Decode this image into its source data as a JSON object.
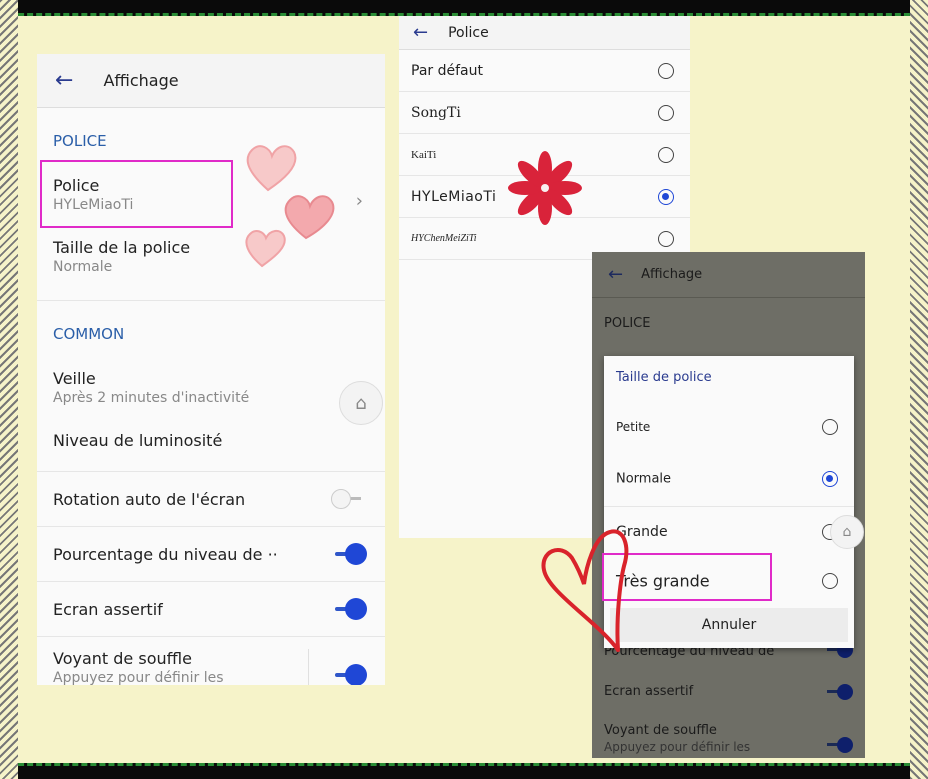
{
  "colors": {
    "background": "#f6f3c9",
    "accent_blue": "#1f47d6",
    "section_blue": "#2a5ea8",
    "highlight_magenta": "#e02ac8",
    "heart_pink": "#f0a3a6",
    "heart_red": "#d9232b"
  },
  "panel1": {
    "back_icon": "arrow-left-icon",
    "title": "Affichage",
    "section_police": "POLICE",
    "police_label": "Police",
    "police_value": "HYLeMiaoTi",
    "taille_label": "Taille de la police",
    "taille_value": "Normale",
    "section_common": "COMMON",
    "veille_label": "Veille",
    "veille_value": "Après 2 minutes d'inactivité",
    "luminosite_label": "Niveau de luminosité",
    "rotation_label": "Rotation auto de l'écran",
    "rotation_on": false,
    "pourcentage_label": "Pourcentage du niveau de ··",
    "pourcentage_on": true,
    "ecran_label": "Ecran assertif",
    "ecran_on": true,
    "voyant_label": "Voyant de souffle",
    "voyant_sub": "Appuyez pour définir les",
    "voyant_on": true,
    "home_icon": "home-icon"
  },
  "panel2": {
    "back_icon": "arrow-left-icon",
    "title": "Police",
    "fonts": [
      {
        "label": "Par défaut",
        "checked": false
      },
      {
        "label": "SongTi",
        "checked": false
      },
      {
        "label": "KaiTi",
        "checked": false
      },
      {
        "label": "HYLeMiaoTi",
        "checked": true
      },
      {
        "label": "HYChenMeiZiTi",
        "checked": false
      }
    ]
  },
  "panel3": {
    "back_icon": "arrow-left-icon",
    "title": "Affichage",
    "section_police": "POLICE",
    "behind_pourcentage": "Pourcentage du niveau de",
    "behind_ecran": "Ecran assertif",
    "behind_voyant": "Voyant de souffle",
    "behind_voyant_sub": "Appuyez pour définir les",
    "dialog": {
      "title": "Taille de police",
      "options": [
        {
          "label": "Petite",
          "checked": false
        },
        {
          "label": "Normale",
          "checked": true
        },
        {
          "label": "Grande",
          "checked": false
        },
        {
          "label": "Très grande",
          "checked": false
        }
      ],
      "cancel": "Annuler"
    },
    "home_icon": "home-icon"
  }
}
